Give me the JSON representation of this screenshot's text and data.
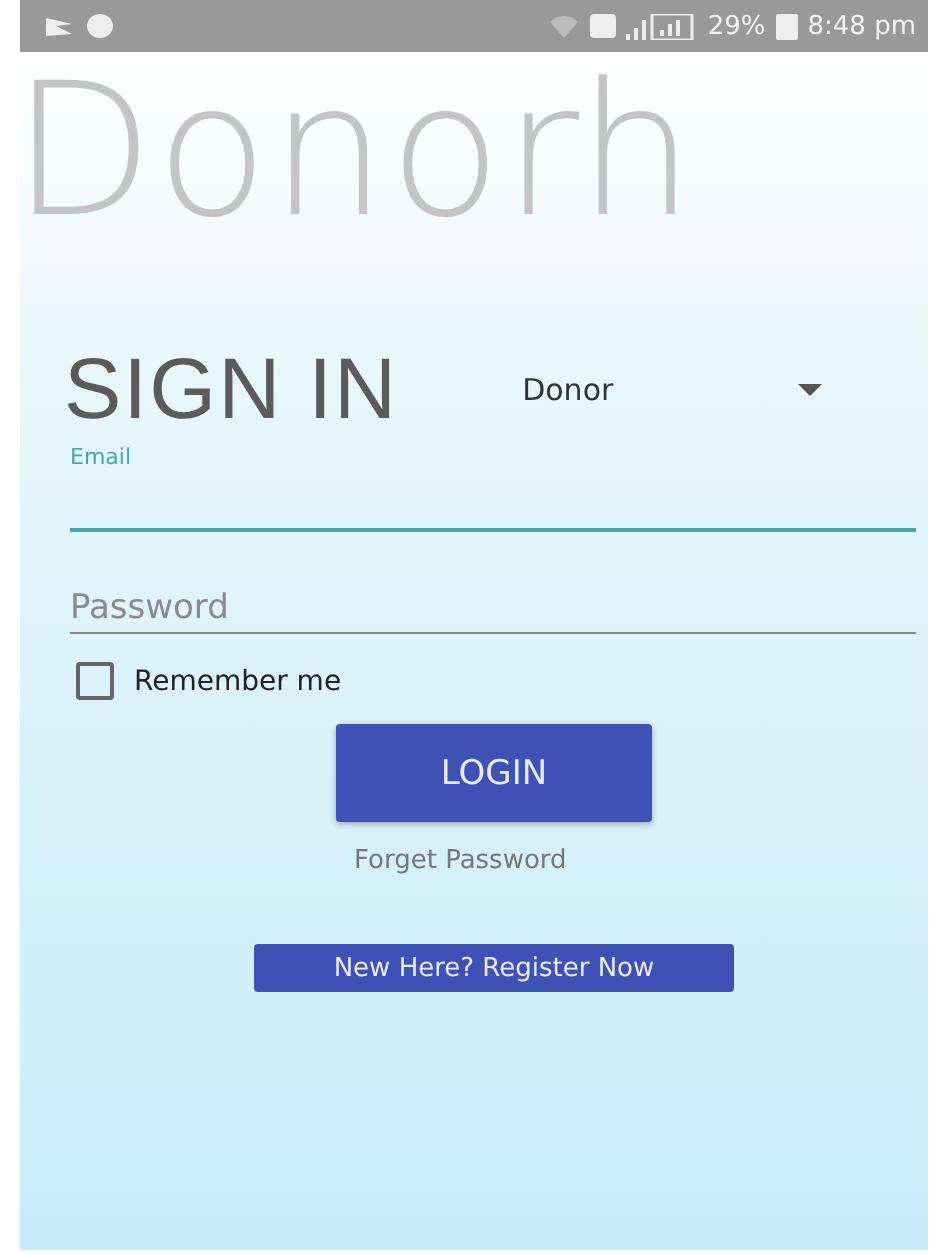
{
  "status_bar": {
    "battery": "29%",
    "time": "8:48 pm"
  },
  "app_title": "Donorh",
  "heading": "SIGN IN",
  "role_dropdown": {
    "value": "Donor"
  },
  "email": {
    "label": "Email",
    "focused": true
  },
  "password": {
    "placeholder": "Password",
    "focused": false
  },
  "remember": {
    "label": "Remember me",
    "checked": false
  },
  "login_button": "LOGIN",
  "forgot_link": "Forget Password",
  "register_button": "New Here? Register Now"
}
